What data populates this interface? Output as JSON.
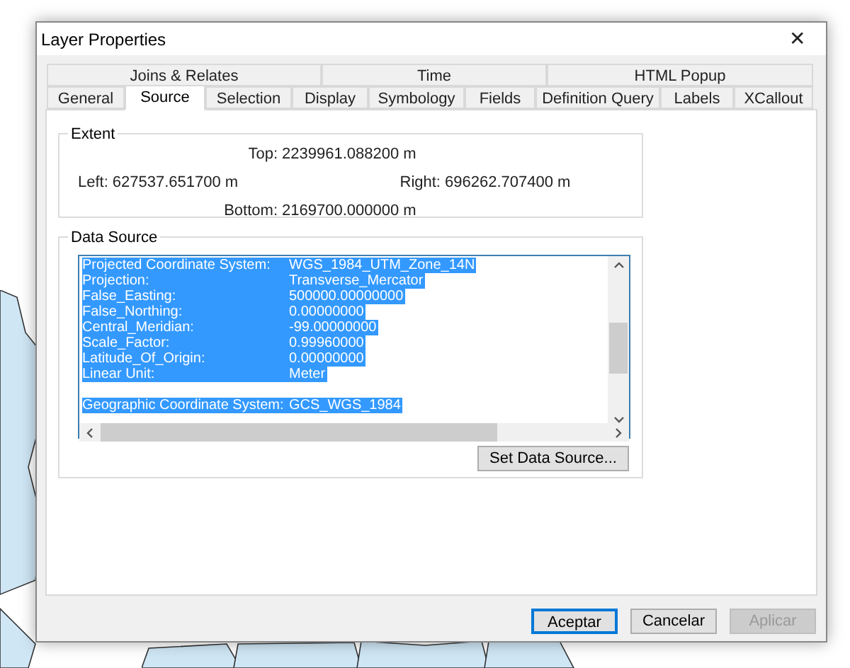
{
  "window": {
    "title": "Layer Properties",
    "close": "✕"
  },
  "tab_rows": [
    [
      {
        "label": "Joins & Relates",
        "selected": false
      },
      {
        "label": "Time",
        "selected": false
      },
      {
        "label": "HTML Popup",
        "selected": false
      }
    ],
    [
      {
        "label": "General",
        "selected": false
      },
      {
        "label": "Source",
        "selected": true
      },
      {
        "label": "Selection",
        "selected": false
      },
      {
        "label": "Display",
        "selected": false
      },
      {
        "label": "Symbology",
        "selected": false
      },
      {
        "label": "Fields",
        "selected": false
      },
      {
        "label": "Definition Query",
        "selected": false
      },
      {
        "label": "Labels",
        "selected": false
      },
      {
        "label": "XCallout",
        "selected": false
      }
    ]
  ],
  "extent": {
    "title": "Extent",
    "top_label": "Top:",
    "top": "2239961.088200 m",
    "left_label": "Left:",
    "left": "627537.651700 m",
    "right_label": "Right:",
    "right": "696262.707400 m",
    "bottom_label": "Bottom:",
    "bottom": "2169700.000000 m"
  },
  "data_source": {
    "title": "Data Source",
    "lines": [
      {
        "kind": "row",
        "label": "Projected Coordinate System:",
        "value": "WGS_1984_UTM_Zone_14N",
        "selected": true
      },
      {
        "kind": "row",
        "label": "Projection:",
        "value": "Transverse_Mercator",
        "selected": true
      },
      {
        "kind": "row",
        "label": "False_Easting:",
        "value": "500000.00000000",
        "selected": true
      },
      {
        "kind": "row",
        "label": "False_Northing:",
        "value": "0.00000000",
        "selected": true
      },
      {
        "kind": "row",
        "label": "Central_Meridian:",
        "value": "-99.00000000",
        "selected": true
      },
      {
        "kind": "row",
        "label": "Scale_Factor:",
        "value": "0.99960000",
        "selected": true
      },
      {
        "kind": "row",
        "label": "Latitude_Of_Origin:",
        "value": "0.00000000",
        "selected": true
      },
      {
        "kind": "row",
        "label": "Linear Unit:",
        "value": "Meter",
        "selected": true
      },
      {
        "kind": "spacer"
      },
      {
        "kind": "row",
        "label": "Geographic Coordinate System:",
        "value": "GCS_WGS_1984",
        "selected": true
      }
    ],
    "button": "Set Data Source..."
  },
  "buttons": [
    {
      "label": "Aceptar",
      "default": true,
      "disabled": false
    },
    {
      "label": "Cancelar",
      "default": false,
      "disabled": false
    },
    {
      "label": "Aplicar",
      "default": false,
      "disabled": true
    }
  ]
}
